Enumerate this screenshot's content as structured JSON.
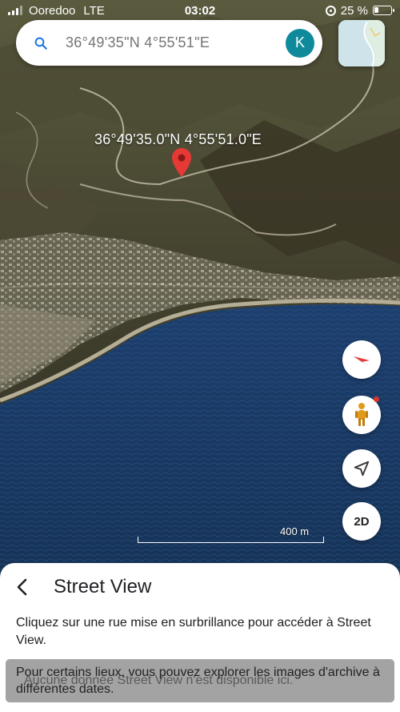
{
  "status_bar": {
    "carrier": "Ooredoo",
    "network": "LTE",
    "time": "03:02",
    "battery": "25 %",
    "battery_level": 0.25
  },
  "search": {
    "placeholder": "36°49'35\"N 4°55'51\"E",
    "avatar_initial": "K"
  },
  "map": {
    "pin_label": "36°49'35.0\"N 4°55'51.0\"E",
    "scale_label": "400 m",
    "view_mode_label": "2D"
  },
  "sheet": {
    "title": "Street View",
    "description": "Cliquez sur une rue mise en surbrillance pour accéder à Street View.",
    "toast_text": "Pour certains lieux, vous pouvez explorer les images d'archive à différentes dates.",
    "toast_underlay": "Aucune donnée Street View n'est disponible ici."
  },
  "icons": {
    "search": "search-icon",
    "back": "back-arrow-icon",
    "compass": "compass-icon",
    "pegman": "pegman-icon",
    "locate": "location-arrow-icon"
  },
  "colors": {
    "accent": "#0f8a9b",
    "pin": "#e53935",
    "sea": "#1f3d66"
  }
}
